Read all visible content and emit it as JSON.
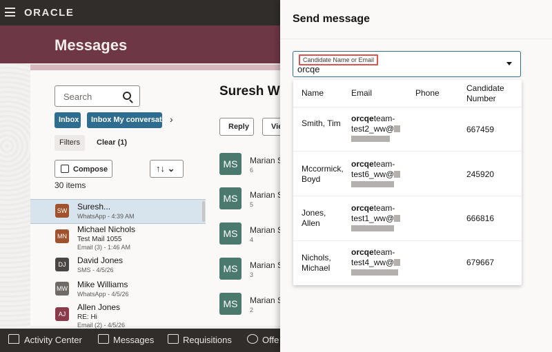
{
  "topbar": {
    "logo": "ORACLE"
  },
  "page": {
    "title": "Messages"
  },
  "left_panel": {
    "search_placeholder": "Search",
    "filter_chips": [
      "Inbox",
      "Inbox My conversation"
    ],
    "filters_label": "Filters",
    "clear_label": "Clear (1)",
    "compose_label": "Compose",
    "sort_icon": "↑↓",
    "items_count": "30 items",
    "items": [
      {
        "initials": "SW",
        "name": "Suresh...",
        "sub": "WhatsApp - 4:39 AM",
        "sub2": "",
        "color": "#a0522d"
      },
      {
        "initials": "MN",
        "name": "Michael Nichols",
        "sub": "Test Mail 1055",
        "sub2": "Email (3) - 1:46 AM",
        "color": "#a0522d"
      },
      {
        "initials": "DJ",
        "name": "David Jones",
        "sub": "SMS - 4/5/26",
        "sub2": "",
        "color": "#4a4643"
      },
      {
        "initials": "MW",
        "name": "Mike Williams",
        "sub": "WhatsApp - 4/5/26",
        "sub2": "",
        "color": "#6f6a66"
      },
      {
        "initials": "AJ",
        "name": "Allen Jones",
        "sub": "RE: Hi",
        "sub2": "Email (2) - 4/5/26",
        "color": "#8b3a4a"
      }
    ]
  },
  "detail": {
    "title": "Suresh W",
    "reply_label": "Reply",
    "view_label": "Vie",
    "messages": [
      {
        "initials": "MS",
        "name": "Marian S",
        "count": "6"
      },
      {
        "initials": "MS",
        "name": "Marian S",
        "count": "5"
      },
      {
        "initials": "MS",
        "name": "Marian S",
        "count": "4"
      },
      {
        "initials": "MS",
        "name": "Marian S",
        "count": "3"
      },
      {
        "initials": "MS",
        "name": "Marian S",
        "count": "2"
      }
    ]
  },
  "bottom_nav": [
    {
      "label": "Activity Center",
      "icon": "home-icon"
    },
    {
      "label": "Messages",
      "icon": "inbox-icon"
    },
    {
      "label": "Requisitions",
      "icon": "list-icon"
    },
    {
      "label": "Offe",
      "icon": "offers-icon"
    }
  ],
  "drawer": {
    "title": "Send message",
    "field": {
      "label": "Candidate Name or Email",
      "value": "orcqe"
    },
    "columns": {
      "name": "Name",
      "email": "Email",
      "phone": "Phone",
      "number": "Candidate Number"
    },
    "results": [
      {
        "name": "Smith, Tim",
        "email_match": "orcqe",
        "email_rest": "team-test2_ww@",
        "phone": "",
        "number": "667459"
      },
      {
        "name": "Mccormick, Boyd",
        "email_match": "orcqe",
        "email_rest": "team-test6_ww@",
        "phone": "",
        "number": "245920"
      },
      {
        "name": "Jones, Allen",
        "email_match": "orcqe",
        "email_rest": "team-test1_ww@",
        "phone": "",
        "number": "666816"
      },
      {
        "name": "Nichols, Michael",
        "email_match": "orcqe",
        "email_rest": "team-test4_ww@",
        "phone": "",
        "number": "679667"
      }
    ]
  }
}
